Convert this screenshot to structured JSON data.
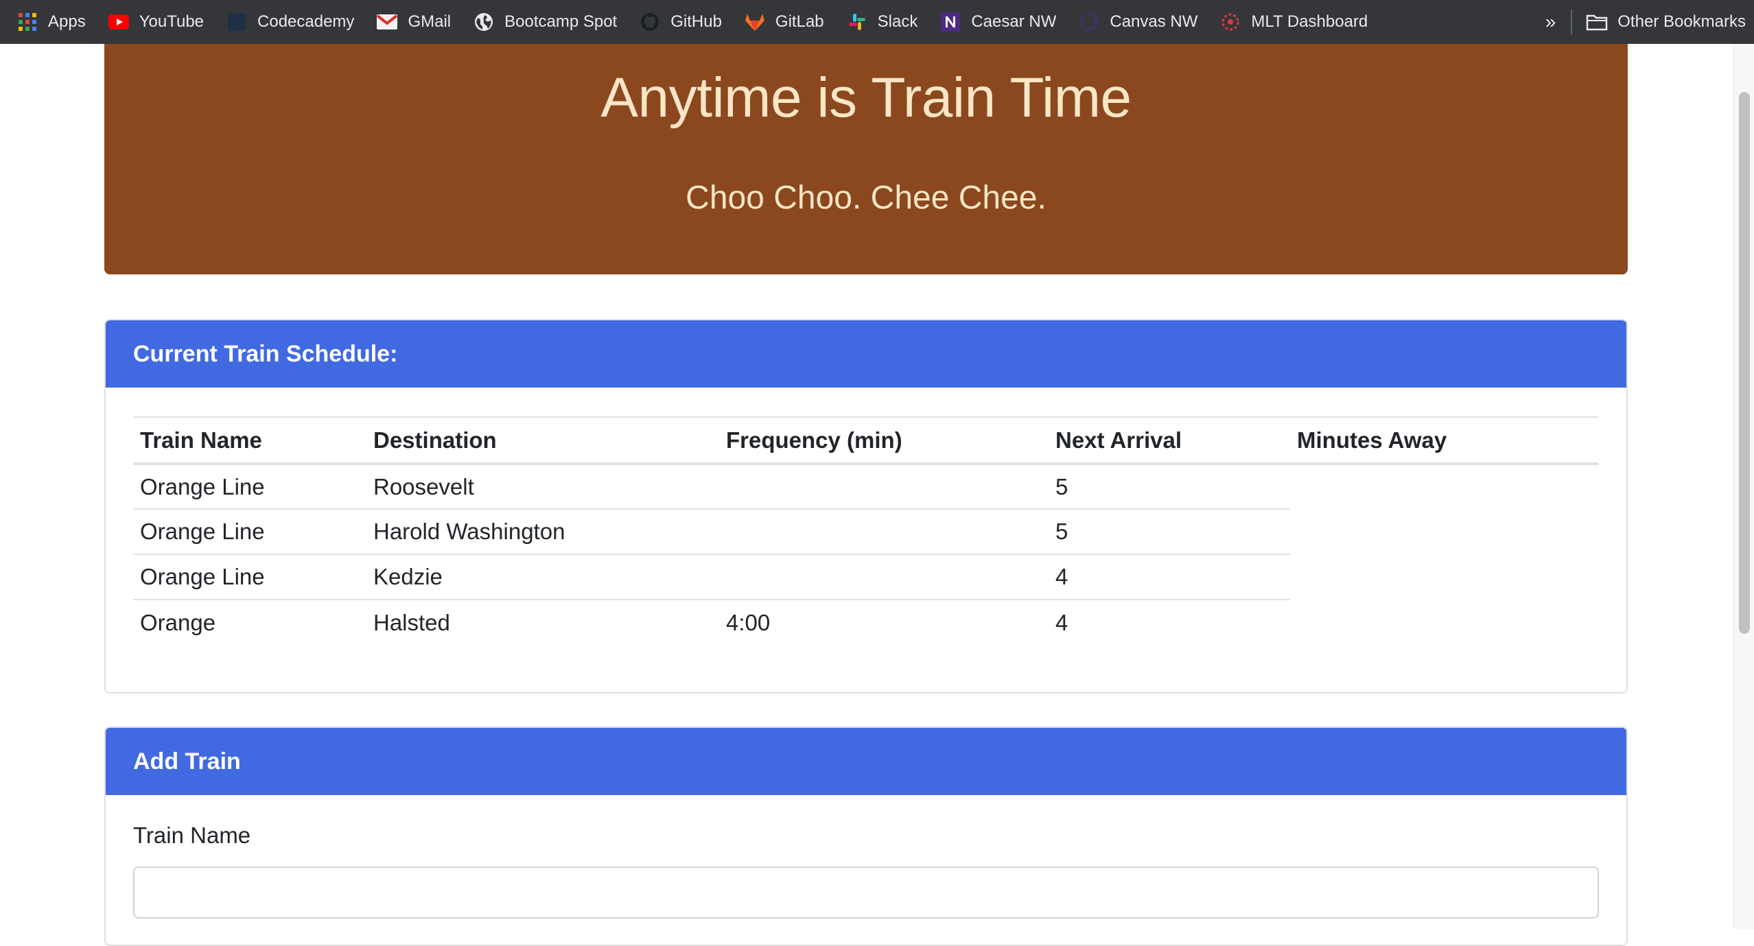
{
  "bookmarks_bar": {
    "items": [
      {
        "label": "Apps",
        "icon": "apps-grid-icon"
      },
      {
        "label": "YouTube",
        "icon": "youtube-icon"
      },
      {
        "label": "Codecademy",
        "icon": "codecademy-icon"
      },
      {
        "label": "GMail",
        "icon": "gmail-icon"
      },
      {
        "label": "Bootcamp Spot",
        "icon": "globe-icon"
      },
      {
        "label": "GitHub",
        "icon": "github-icon"
      },
      {
        "label": "GitLab",
        "icon": "gitlab-icon"
      },
      {
        "label": "Slack",
        "icon": "slack-icon"
      },
      {
        "label": "Caesar NW",
        "icon": "northwestern-icon"
      },
      {
        "label": "Canvas NW",
        "icon": "canvas-icon"
      },
      {
        "label": "MLT Dashboard",
        "icon": "mlt-icon"
      }
    ],
    "overflow": "»",
    "other_bookmarks": "Other Bookmarks"
  },
  "jumbotron": {
    "title": "Anytime is Train Time",
    "subtitle": "Choo Choo. Chee Chee."
  },
  "schedule": {
    "header": "Current Train Schedule:",
    "columns": [
      "Train Name",
      "Destination",
      "Frequency (min)",
      "Next Arrival",
      "Minutes Away"
    ],
    "rows": [
      {
        "name": "Orange Line",
        "destination": "Roosevelt",
        "frequency": "",
        "next_arrival": "5",
        "minutes_away": ""
      },
      {
        "name": "Orange Line",
        "destination": "Harold Washington",
        "frequency": "",
        "next_arrival": "5",
        "minutes_away": ""
      },
      {
        "name": "Orange Line",
        "destination": "Kedzie",
        "frequency": "",
        "next_arrival": "4",
        "minutes_away": ""
      },
      {
        "name": "Orange",
        "destination": "Halsted",
        "frequency": "4:00",
        "next_arrival": "4",
        "minutes_away": ""
      }
    ]
  },
  "add_train": {
    "header": "Add Train",
    "train_name_label": "Train Name",
    "train_name_value": ""
  },
  "colors": {
    "bookmarks_bg": "#35363a",
    "jumbotron_bg": "#8b481e",
    "jumbotron_text": "#fbe6c6",
    "card_header_bg": "#4169e1"
  }
}
